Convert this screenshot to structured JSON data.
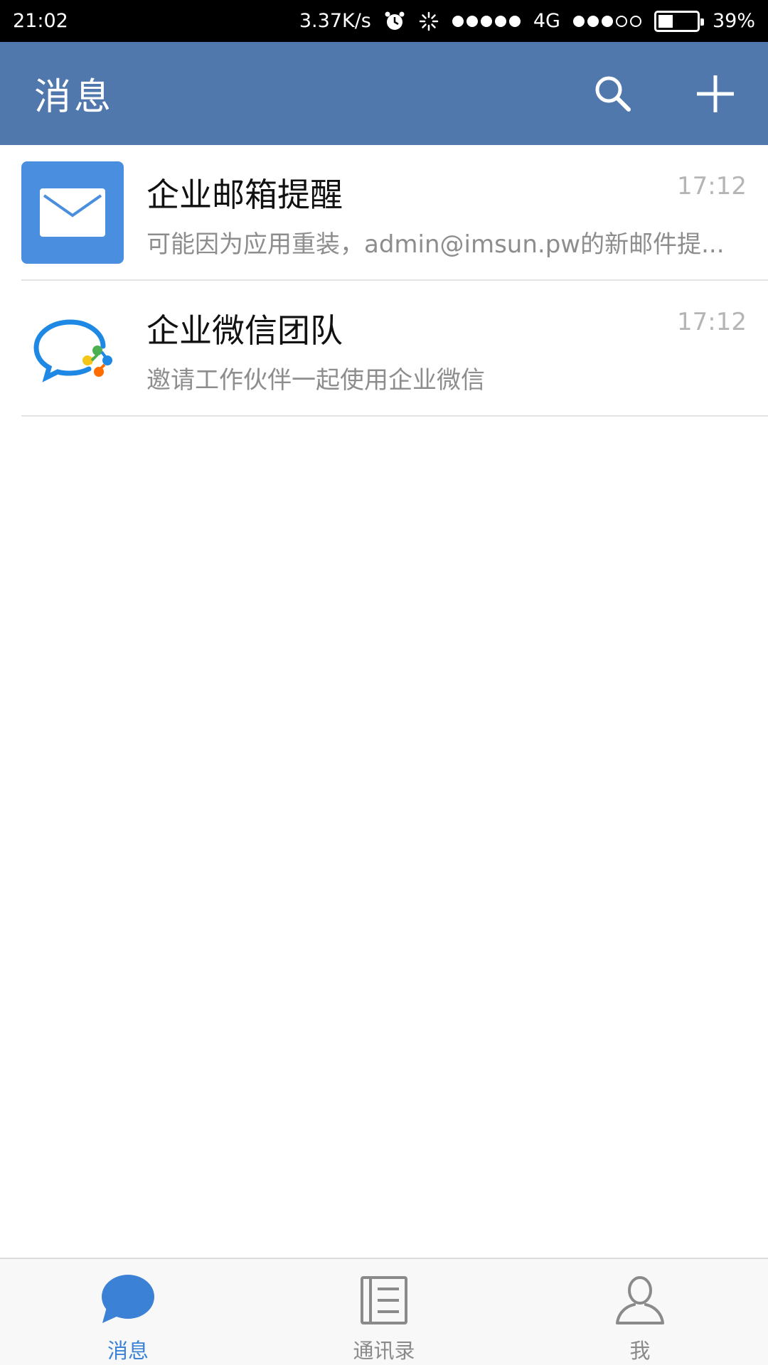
{
  "status_bar": {
    "time": "21:02",
    "network_speed": "3.37K/s",
    "network_type": "4G",
    "battery_percent": "39%",
    "battery_level": 0.39,
    "signal1_bars": 5,
    "signal2_bars": 3,
    "icons": [
      "alarm-icon",
      "loading-icon",
      "signal-icon",
      "battery-icon"
    ]
  },
  "header": {
    "title": "消息",
    "actions": [
      "search-icon",
      "plus-icon"
    ]
  },
  "messages": [
    {
      "avatar_icon": "mail-icon",
      "title": "企业邮箱提醒",
      "preview": "可能因为应用重装，admin@imsun.pw的新邮件提...",
      "time": "17:12"
    },
    {
      "avatar_icon": "wecom-logo-icon",
      "title": "企业微信团队",
      "preview": "邀请工作伙伴一起使用企业微信",
      "time": "17:12"
    }
  ],
  "tabs": [
    {
      "label": "消息",
      "icon": "chat-bubble-icon",
      "active": true
    },
    {
      "label": "通讯录",
      "icon": "contacts-book-icon",
      "active": false
    },
    {
      "label": "我",
      "icon": "person-icon",
      "active": false
    }
  ],
  "colors": {
    "header": "#5078ad",
    "accent": "#3b82d6",
    "mail_avatar": "#4a8ee0"
  }
}
